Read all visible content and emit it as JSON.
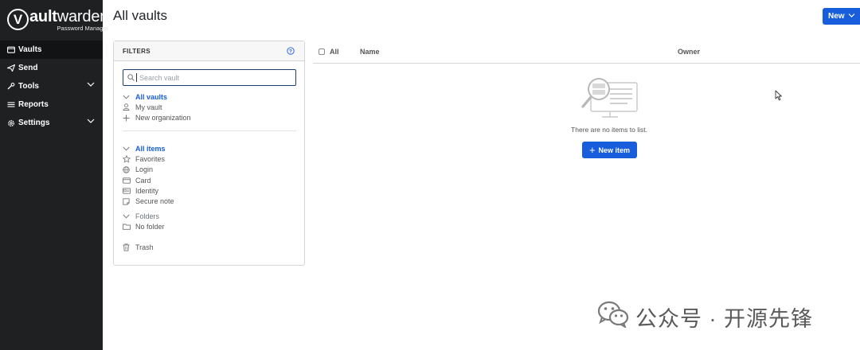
{
  "app": {
    "logo_word_bold": "ault",
    "logo_word_rest": "warden",
    "logo_letter": "V",
    "logo_sub": "Password Manager"
  },
  "sidebar": {
    "items": [
      {
        "label": "Vaults",
        "icon": "vault-icon",
        "active": true
      },
      {
        "label": "Send",
        "icon": "send-icon"
      },
      {
        "label": "Tools",
        "icon": "tools-icon",
        "expandable": true
      },
      {
        "label": "Reports",
        "icon": "reports-icon"
      },
      {
        "label": "Settings",
        "icon": "settings-icon",
        "expandable": true
      }
    ]
  },
  "header": {
    "title": "All vaults",
    "new_button": "New"
  },
  "filters": {
    "title": "FILTERS",
    "search_placeholder": "Search vault",
    "vaults": {
      "heading": "All vaults",
      "items": [
        "My vault",
        "New organization"
      ]
    },
    "types": {
      "heading": "All items",
      "items": [
        "Favorites",
        "Login",
        "Card",
        "Identity",
        "Secure note"
      ]
    },
    "folders": {
      "heading": "Folders",
      "items": [
        "No folder"
      ]
    },
    "trash": "Trash"
  },
  "table": {
    "col_all": "All",
    "col_name": "Name",
    "col_owner": "Owner",
    "empty_text": "There are no items to list.",
    "new_item_button": "New item"
  },
  "watermark": {
    "text": "公众号 · 开源先锋"
  },
  "colors": {
    "sidebar_bg": "#1f2022",
    "accent": "#175ddc"
  }
}
